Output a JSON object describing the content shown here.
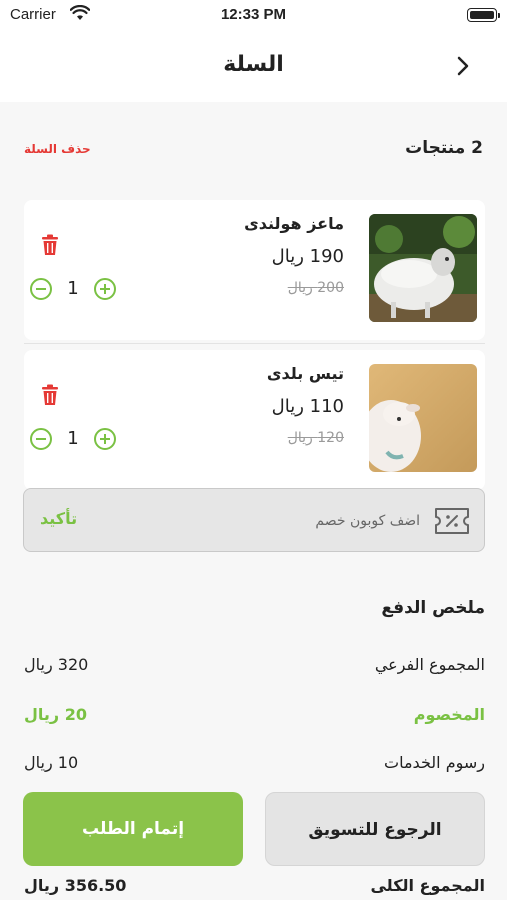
{
  "status_bar": {
    "carrier": "Carrier",
    "time": "12:33 PM"
  },
  "nav": {
    "title": "السلة"
  },
  "cart": {
    "count_label": "2 منتجات",
    "clear_label": "حذف السلة"
  },
  "items": [
    {
      "name": "ماعز هولندى",
      "price": "190 ريال",
      "old_price": "200 ريال",
      "qty": "1",
      "image": "sheep-photo"
    },
    {
      "name": "تيس بلدى",
      "price": "110 ريال",
      "old_price": "120 ريال",
      "qty": "1",
      "image": "lamb-photo"
    }
  ],
  "coupon": {
    "placeholder": "اضف كوبون خصم",
    "confirm_label": "تأكيد",
    "icon": "coupon-ticket-icon"
  },
  "summary": {
    "title": "ملخص الدفع",
    "subtotal_label": "المجموع الفرعي",
    "subtotal_value": "320 ريال",
    "discount_label": "المخصوم",
    "discount_value": "20 ريال",
    "fees_label": "رسوم الخدمات",
    "fees_value": "10 ريال",
    "total_label": "المجموع الكلى",
    "total_value": "356.50 ريال"
  },
  "actions": {
    "checkout_label": "إتمام الطلب",
    "continue_label": "الرجوع للتسويق"
  },
  "colors": {
    "accent": "#8bc34a",
    "danger": "#e53935"
  }
}
